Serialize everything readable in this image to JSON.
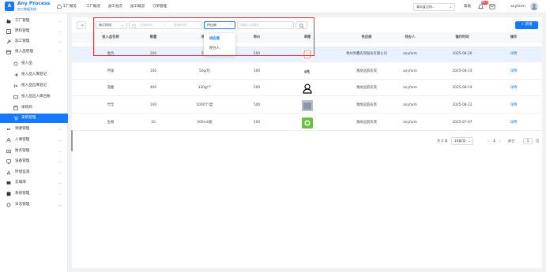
{
  "brand": {
    "name": "Any Process",
    "subtitle": "加工数据系统"
  },
  "topnav": [
    {
      "label": "工厂概览"
    },
    {
      "label": "工厂概况"
    },
    {
      "label": "加工批次"
    },
    {
      "label": "加工概况"
    },
    {
      "label": "订单管理"
    }
  ],
  "header": {
    "factory": "青岛爱记科...",
    "help": "帮助",
    "notifications": "99+",
    "user": "anyfarm"
  },
  "sidebar": {
    "items": [
      {
        "label": "工厂管理",
        "icon": "factory-icon",
        "expandable": true
      },
      {
        "label": "原料管理",
        "icon": "material-icon",
        "expandable": true
      },
      {
        "label": "加工管理",
        "icon": "hammer-icon",
        "expandable": true
      },
      {
        "label": "投入品管理",
        "icon": "box-icon",
        "expandable": true,
        "expanded": true
      },
      {
        "label": "投入品",
        "icon": "circle-icon",
        "sub": true
      },
      {
        "label": "投入品入库登记",
        "icon": "inbound-icon",
        "sub": true
      },
      {
        "label": "投入品出库登记",
        "icon": "outbound-icon",
        "sub": true
      },
      {
        "label": "投入品出入库台账",
        "icon": "ledger-icon",
        "sub": true
      },
      {
        "label": "采购商",
        "icon": "store-icon",
        "sub": true
      },
      {
        "label": "采购管理",
        "icon": "cart-icon",
        "sub": true,
        "active": true
      },
      {
        "label": "溯源管理",
        "icon": "trace-icon",
        "expandable": true
      },
      {
        "label": "人事管理",
        "icon": "person-icon",
        "expandable": true
      },
      {
        "label": "财务管理",
        "icon": "finance-icon",
        "expandable": true
      },
      {
        "label": "设备管理",
        "icon": "device-icon",
        "expandable": true
      },
      {
        "label": "环境监测",
        "icon": "environment-icon",
        "expandable": true
      },
      {
        "label": "云端库",
        "icon": "cloud-icon",
        "expandable": true
      },
      {
        "label": "系统管理",
        "icon": "system-icon",
        "expandable": true
      },
      {
        "label": "日志管理",
        "icon": "log-icon",
        "expandable": true
      }
    ]
  },
  "filters": {
    "time_type": "按订时间",
    "start_placeholder": "开始时间",
    "end_placeholder": "结束时间",
    "range_sep": "-",
    "supplier_select": "供应商",
    "keyword_placeholder": "请输入关键词",
    "dropdown": [
      {
        "label": "供应商",
        "selected": true
      },
      {
        "label": "经办人",
        "selected": false
      }
    ]
  },
  "toolbar": {
    "add_label": "+ 新增"
  },
  "table": {
    "headers": [
      "投入品名称",
      "数量",
      "单位",
      "",
      "单价",
      "单图",
      "供应商",
      "经办人",
      "操作时间",
      "操作"
    ],
    "rows": [
      {
        "name": "复合",
        "qty": "200",
        "spec": "500",
        "price": "500",
        "image": "pill-image",
        "supplier": "杭州洪鑫农资股份有限公司",
        "handler": "anyfarm",
        "time": "2025-08-20",
        "op": "详情",
        "selected": true
      },
      {
        "name": "钙铵",
        "qty": "100",
        "spec": "50g/包",
        "price": "500",
        "image": "granules-image",
        "supplier": "潍坊远航农资",
        "handler": "anyfarm",
        "time": "2025-08-14",
        "op": "详情",
        "selected": false
      },
      {
        "name": "盐酸",
        "qty": "400",
        "spec": "330g/个",
        "price": "500",
        "image": "person-image",
        "supplier": "潍坊远航农资",
        "handler": "anyfarm",
        "time": "2025-08-14",
        "op": "详情",
        "selected": false
      },
      {
        "name": "竹竿",
        "qty": "100",
        "spec": "1000个/盒",
        "price": "500",
        "image": "sack-image",
        "supplier": "潍坊远航农资",
        "handler": "anyfarm",
        "time": "2025-08-12",
        "op": "详情",
        "selected": false
      },
      {
        "name": "生根",
        "qty": "10",
        "spec": "500ml/瓶",
        "price": "500",
        "image": "green-logo-image",
        "supplier": "潍坊远航农资",
        "handler": "anyfarm",
        "time": "2025-07-07",
        "op": "详情",
        "selected": false
      }
    ]
  },
  "pagination": {
    "total": "共 5 条",
    "page_size": "10条/页",
    "current": "1",
    "jump_label": "前往",
    "jump_value": "1",
    "page_suffix": "页"
  },
  "colors": {
    "accent": "#1677ff",
    "highlight_border": "#e0303a",
    "selected_row": "#e8f1fd"
  }
}
